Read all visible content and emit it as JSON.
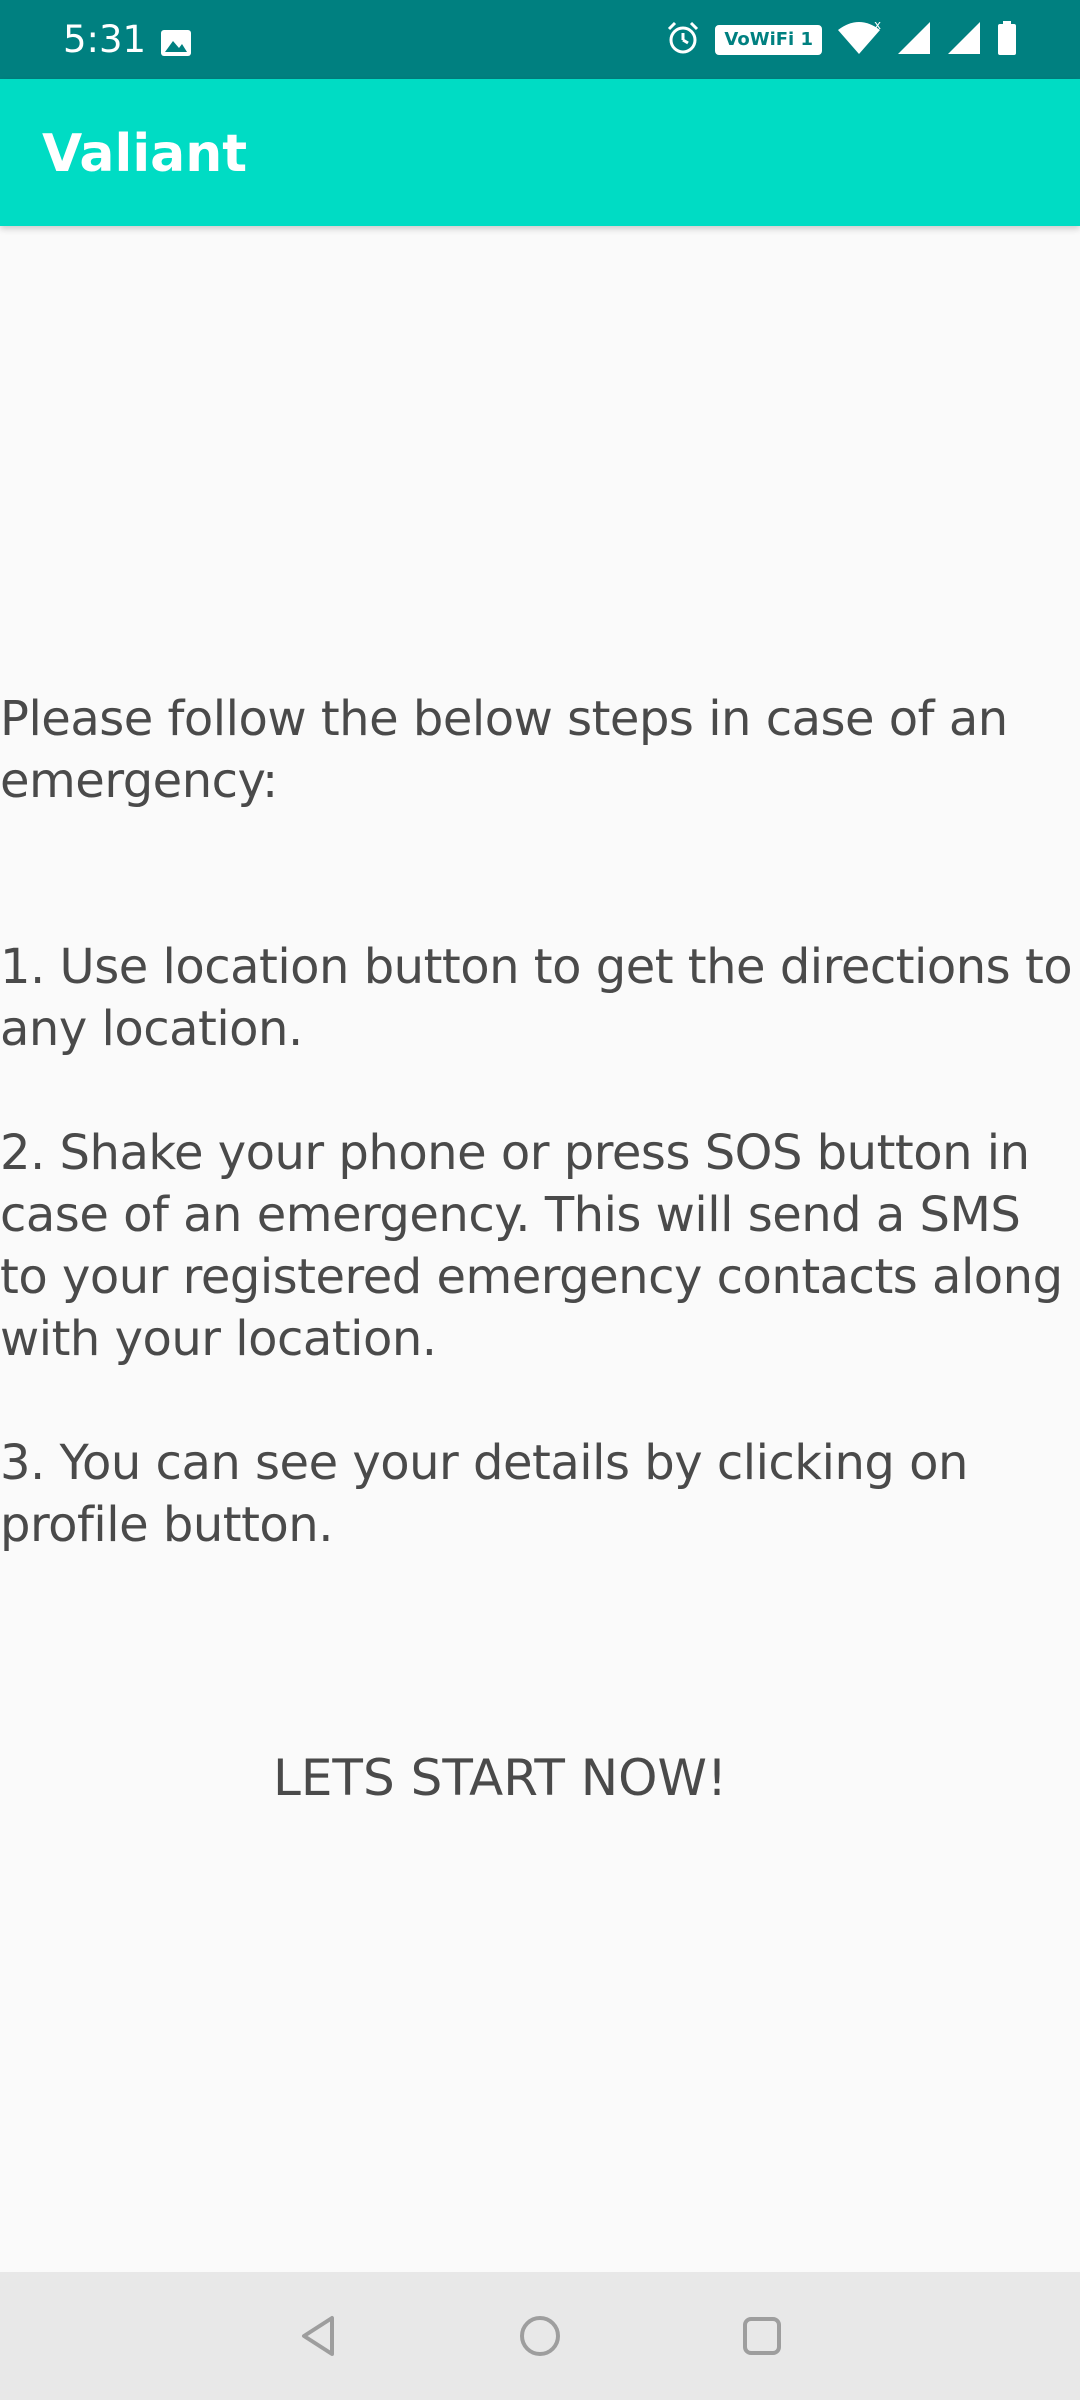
{
  "status_bar": {
    "time": "5:31",
    "wifi_badge": "VoWiFi 1",
    "icons": [
      "image-icon",
      "alarm-icon",
      "vowifi-icon",
      "wifi-icon",
      "signal-icon",
      "signal-icon",
      "battery-icon"
    ],
    "background": "#008080"
  },
  "app_bar": {
    "title": "Valiant",
    "background": "#00dcc4"
  },
  "instructions": {
    "intro": "Please follow the below steps in case of an emergency:",
    "steps": [
      "1. Use location button to get the directions to any location.",
      "2. Shake your phone or press SOS button in case of an emergency. This will send a SMS to your registered emergency contacts along with your location.",
      "3. You can see your details by clicking on profile button."
    ]
  },
  "start_button": {
    "label": "LETS START NOW!"
  },
  "nav_bar": {
    "buttons": [
      "back-icon",
      "home-icon",
      "recent-apps-icon"
    ],
    "background": "#e8e8e8"
  }
}
